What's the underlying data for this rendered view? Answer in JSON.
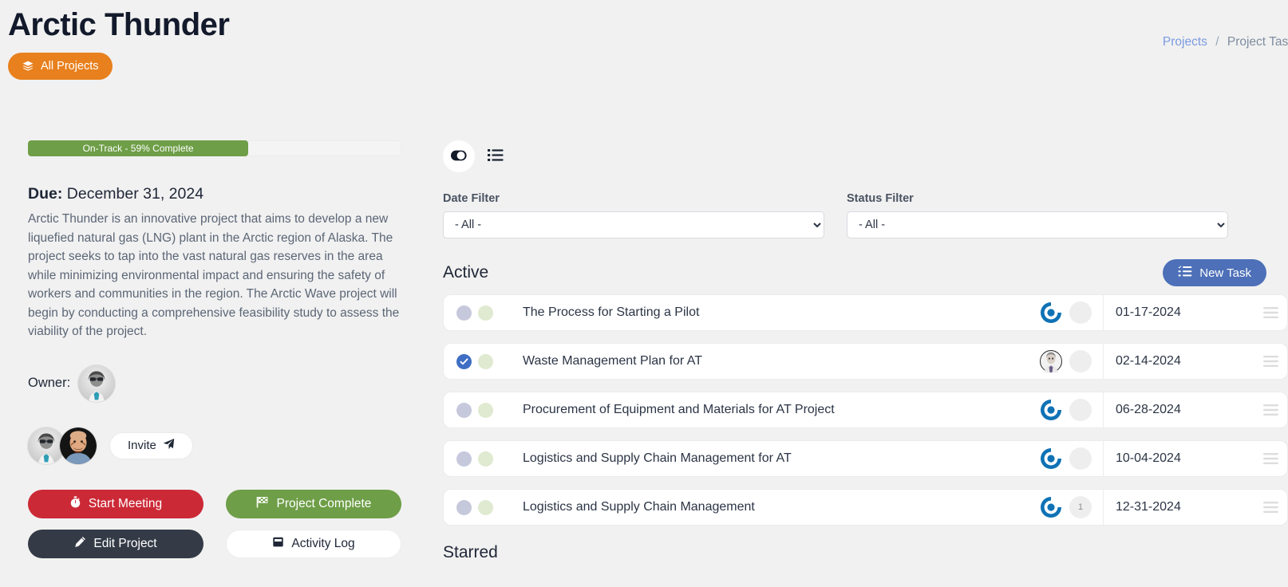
{
  "header": {
    "title": "Arctic Thunder",
    "all_projects_label": "All Projects",
    "all_projects_icon": "layers-stack-icon",
    "accent_orange": "#e8801d"
  },
  "breadcrumb": {
    "root_label": "Projects",
    "separator": "/",
    "current_label": "Project Task"
  },
  "overview": {
    "progress": {
      "label": "On-Track - 59% Complete",
      "percent": 59,
      "bar_color": "#6e9e47"
    },
    "due_label": "Due:",
    "due_date": "December 31, 2024",
    "description": "Arctic Thunder is an innovative project that aims to develop a new liquefied natural gas (LNG) plant in the Arctic region of Alaska. The project seeks to tap into the vast natural gas reserves in the area while minimizing environmental impact and ensuring the safety of workers and communities in the region. The Arctic Wave project will begin by conducting a comprehensive feasibility study to assess the viability of the project.",
    "owner_label": "Owner:",
    "invite_label": "Invite",
    "invite_icon": "paper-plane-icon"
  },
  "actions": {
    "start_meeting": {
      "label": "Start Meeting",
      "icon": "stopwatch-icon",
      "color": "#cc2936"
    },
    "project_complete": {
      "label": "Project Complete",
      "icon": "checkered-flag-icon",
      "color": "#6e9e47"
    },
    "edit_project": {
      "label": "Edit Project",
      "icon": "pencil-icon",
      "color": "#343b47"
    },
    "activity_log": {
      "label": "Activity Log",
      "icon": "book-icon",
      "color": "#ffffff"
    }
  },
  "view_toggles": {
    "board_icon": "toggle-board-icon",
    "list_icon": "list-view-icon"
  },
  "filters": {
    "date": {
      "label": "Date Filter",
      "value": "- All -",
      "options": [
        "- All -"
      ]
    },
    "status": {
      "label": "Status Filter",
      "value": "- All -",
      "options": [
        "- All -"
      ]
    }
  },
  "tasks_section": {
    "active_title": "Active",
    "starred_title": "Starred",
    "new_task_label": "New Task",
    "new_task_icon": "task-list-icon",
    "new_task_color": "#4d70b8",
    "rows": [
      {
        "checked": false,
        "title": "The Process for Starting a Pilot",
        "assignee_type": "power-badge",
        "badge_count": "",
        "date": "01-17-2024"
      },
      {
        "checked": true,
        "title": "Waste Management Plan for AT",
        "assignee_type": "avatar",
        "badge_count": "",
        "date": "02-14-2024"
      },
      {
        "checked": false,
        "title": "Procurement of Equipment and Materials for AT Project",
        "assignee_type": "power-badge",
        "badge_count": "",
        "date": "06-28-2024"
      },
      {
        "checked": false,
        "title": "Logistics and Supply Chain Management for AT",
        "assignee_type": "power-badge",
        "badge_count": "",
        "date": "10-04-2024"
      },
      {
        "checked": false,
        "title": "Logistics and Supply Chain Management",
        "assignee_type": "power-badge",
        "badge_count": "1",
        "date": "12-31-2024"
      }
    ]
  }
}
